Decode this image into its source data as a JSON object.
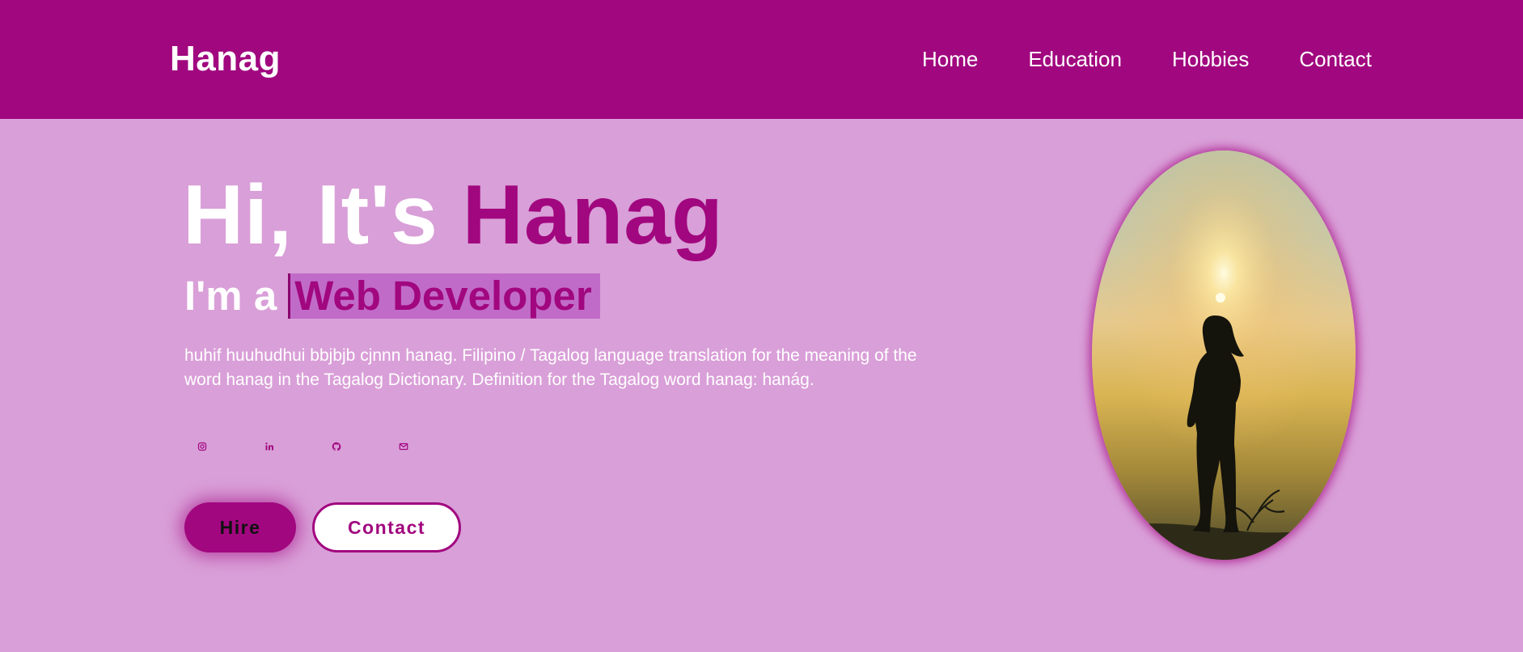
{
  "header": {
    "logo": "Hanag",
    "nav": [
      {
        "label": "Home"
      },
      {
        "label": "Education"
      },
      {
        "label": "Hobbies"
      },
      {
        "label": "Contact"
      }
    ]
  },
  "hero": {
    "greeting": "Hi, It's ",
    "name": "Hanag",
    "role_prefix": "I'm a ",
    "role": "Web Developer",
    "description": "huhif huuhudhui bbjbjb cjnnn hanag. Filipino / Tagalog language translation for the meaning of the word hanag in the Tagalog Dictionary. Definition for the Tagalog word hanag: hanág.",
    "socials": [
      {
        "icon": "instagram-icon"
      },
      {
        "icon": "linkedin-icon"
      },
      {
        "icon": "github-icon"
      },
      {
        "icon": "mail-icon"
      }
    ],
    "buttons": {
      "hire": "Hire",
      "contact": "Contact"
    }
  },
  "colors": {
    "accent": "#a1077f",
    "background": "#d99fd8",
    "highlight": "#c16bc9"
  }
}
